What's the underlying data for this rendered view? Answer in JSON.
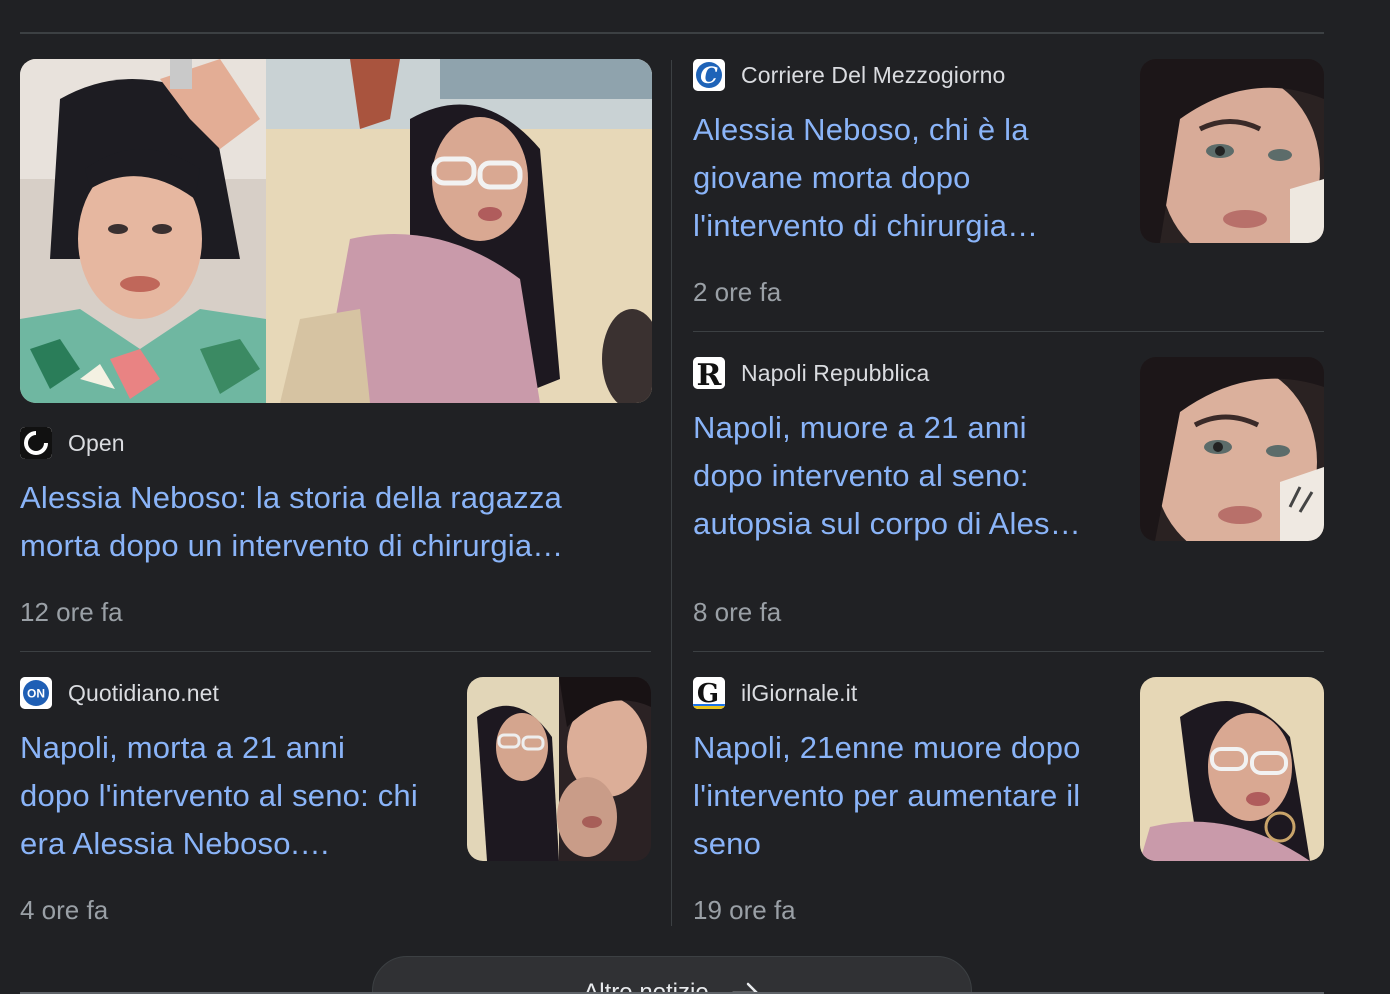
{
  "articles": [
    {
      "source": "Open",
      "favicon_icon": "open-ring-icon",
      "headline_lines": [
        "Alessia Neboso: la storia della ragazza",
        "morta dopo un intervento di chirurgia…"
      ],
      "time": "12 ore fa",
      "thumbnail": "photo-collage-woman"
    },
    {
      "source": "Corriere Del Mezzogiorno",
      "favicon_icon": "corriere-c-icon",
      "headline_lines": [
        "Alessia Neboso, chi è la",
        "giovane morta dopo",
        "l'intervento di chirurgia…"
      ],
      "time": "2 ore fa",
      "thumbnail": "portrait-woman-face"
    },
    {
      "source": "Napoli Repubblica",
      "favicon_icon": "repubblica-r-icon",
      "headline_lines": [
        "Napoli, muore a 21 anni",
        "dopo intervento al seno:",
        "autopsia sul corpo di Ales…"
      ],
      "time": "8 ore fa",
      "thumbnail": "portrait-woman-face"
    },
    {
      "source": "Quotidiano.net",
      "favicon_icon": "quotidiano-on-icon",
      "headline_lines": [
        "Napoli, morta a 21 anni",
        "dopo l'intervento al seno: chi",
        "era Alessia Neboso.…"
      ],
      "time": "4 ore fa",
      "thumbnail": "photo-collage-woman"
    },
    {
      "source": "ilGiornale.it",
      "favicon_icon": "giornale-g-icon",
      "headline_lines": [
        "Napoli, 21enne muore dopo",
        "l'intervento per aumentare il",
        "seno"
      ],
      "time": "19 ore fa",
      "thumbnail": "beach-selfie-woman"
    }
  ],
  "more_button": {
    "label": "Altre notizie",
    "icon": "arrow-right-icon"
  },
  "colors": {
    "background": "#202124",
    "headline": "#8ab4f8",
    "source": "#dadce0",
    "time": "#9aa0a6",
    "divider": "#3c4043"
  }
}
